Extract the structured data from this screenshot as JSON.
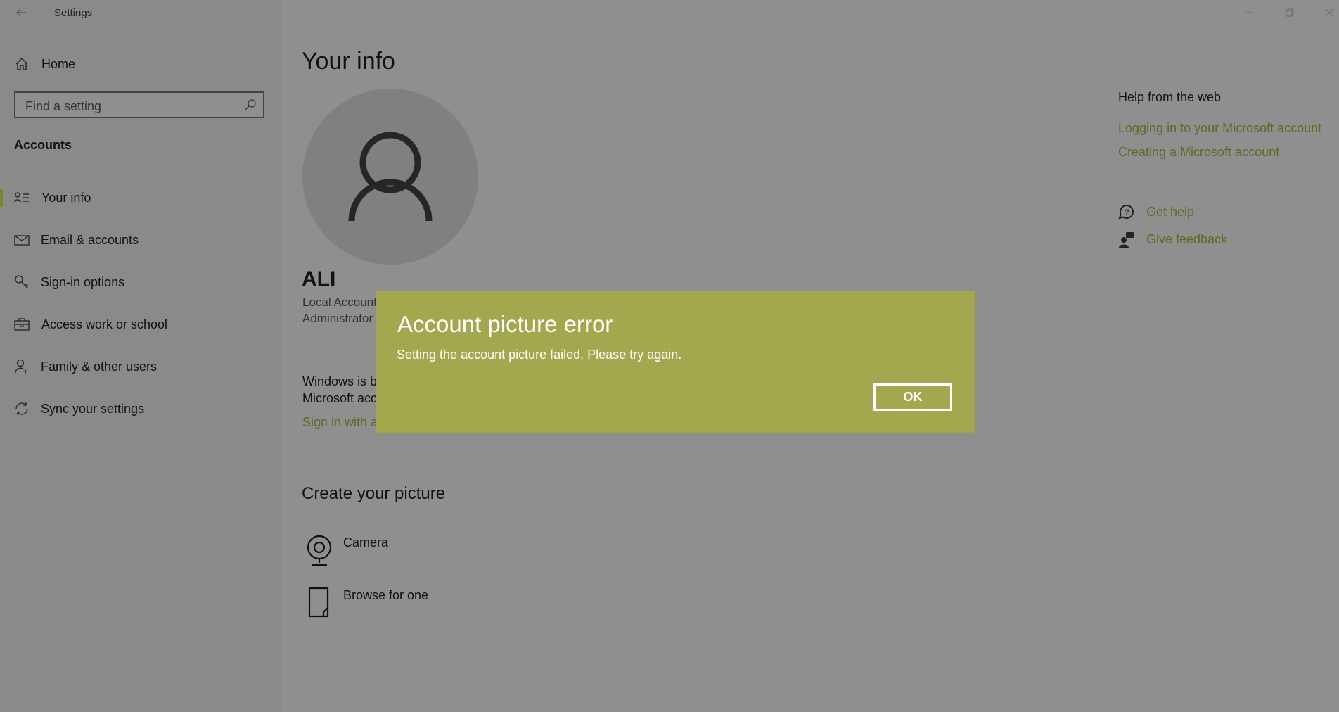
{
  "window": {
    "title": "Settings",
    "back_icon": "back-arrow-icon",
    "controls": [
      "minimize-icon",
      "restore-icon",
      "close-icon"
    ]
  },
  "sidebar": {
    "home_label": "Home",
    "search_placeholder": "Find a setting",
    "section_title": "Accounts",
    "items": [
      {
        "label": "Your info",
        "icon": "user-list-icon",
        "selected": true
      },
      {
        "label": "Email & accounts",
        "icon": "mail-icon"
      },
      {
        "label": "Sign-in options",
        "icon": "key-icon"
      },
      {
        "label": "Access work or school",
        "icon": "briefcase-icon"
      },
      {
        "label": "Family & other users",
        "icon": "person-add-icon"
      },
      {
        "label": "Sync your settings",
        "icon": "sync-icon"
      }
    ],
    "accent_color": "#7a8530"
  },
  "main": {
    "title": "Your info",
    "username": "ALI",
    "account_type": "Local Account",
    "role": "Administrator",
    "windows_text_line1": "Windows is be",
    "windows_text_line2": "Microsoft acc",
    "sign_in_link": "Sign in with a",
    "create_picture_title": "Create your picture",
    "options": [
      {
        "label": "Camera",
        "icon": "camera-icon"
      },
      {
        "label": "Browse for one",
        "icon": "browse-file-icon"
      }
    ]
  },
  "help": {
    "title": "Help from the web",
    "links": [
      "Logging in to your Microsoft account",
      "Creating a Microsoft account"
    ],
    "get_help": "Get help",
    "give_feedback": "Give feedback"
  },
  "dialog": {
    "title": "Account picture error",
    "message": "Setting the account picture failed. Please try again.",
    "ok_label": "OK",
    "bg_color": "#a3a84e"
  }
}
